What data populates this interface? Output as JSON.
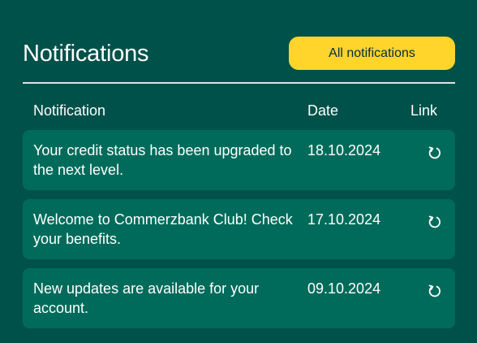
{
  "header": {
    "title": "Notifications",
    "all_button_label": "All notifications"
  },
  "columns": {
    "notification": "Notification",
    "date": "Date",
    "link": "Link"
  },
  "rows": [
    {
      "message": "Your credit status has been upgraded to the next level.",
      "date": "18.10.2024",
      "link_icon": "refresh-icon"
    },
    {
      "message": "Welcome to Commerzbank Club! Check your benefits.",
      "date": "17.10.2024",
      "link_icon": "refresh-icon"
    },
    {
      "message": "New updates are available for your account.",
      "date": "09.10.2024",
      "link_icon": "refresh-icon"
    }
  ],
  "colors": {
    "background": "#00514A",
    "row_background": "#006B5A",
    "accent_button": "#FFD42B",
    "button_text": "#002E3C",
    "text": "#FFFFFF"
  }
}
